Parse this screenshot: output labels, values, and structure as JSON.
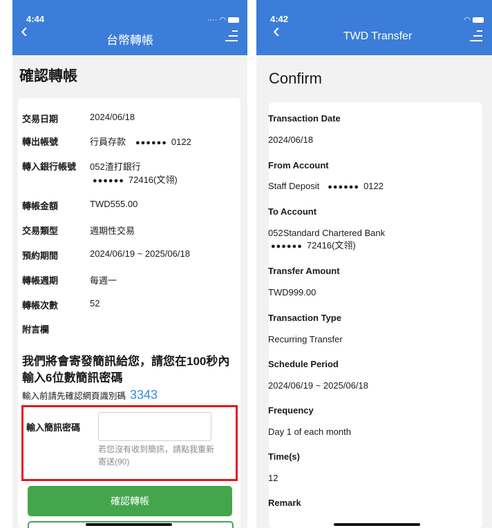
{
  "left": {
    "status_time": "4:44",
    "nav_title": "台幣轉帳",
    "page_title": "確認轉帳",
    "rows": [
      {
        "label": "交易日期",
        "value": "2024/06/18"
      },
      {
        "label": "轉出帳號",
        "value": "行員存款",
        "mask": "●●●●●●",
        "tail": "0122"
      },
      {
        "label": "轉入銀行帳號",
        "value": "052渣打銀行",
        "mask": "●●●●●●",
        "tail": "72416(文翎)"
      },
      {
        "label": "轉帳金額",
        "value": "TWD555.00"
      },
      {
        "label": "交易類型",
        "value": "週期性交易"
      },
      {
        "label": "預約期間",
        "value": "2024/06/19 ~ 2025/06/18"
      },
      {
        "label": "轉帳週期",
        "value": "每週一"
      },
      {
        "label": "轉帳次數",
        "value": "52"
      },
      {
        "label": "附言欄",
        "value": ""
      }
    ],
    "notice": "我們將會寄發簡訊給您，請您在100秒內輸入6位數簡訊密碼",
    "verify_label": "輸入前請先確認網頁識別碼",
    "verify_code": "3343",
    "sms_label": "輸入簡訊密碼",
    "sms_value": "",
    "resend_text": "若您沒有收到簡訊，請點我重新寄送(90)",
    "confirm_button": "確認轉帳"
  },
  "right": {
    "status_time": "4:42",
    "nav_title": "TWD Transfer",
    "page_title": "Confirm",
    "rows": [
      {
        "label": "Transaction Date",
        "value": "2024/06/18"
      },
      {
        "label": "From Account",
        "value": "Staff Deposit",
        "mask": "●●●●●●",
        "tail": "0122"
      },
      {
        "label": "To Account",
        "value": "052Standard Chartered Bank",
        "mask": "●●●●●●",
        "tail": "72416(文翎)"
      },
      {
        "label": "Transfer Amount",
        "value": "TWD999.00"
      },
      {
        "label": "Transaction Type",
        "value": "Recurring Transfer"
      },
      {
        "label": "Schedule Period",
        "value": "2024/06/19 ~ 2025/06/18"
      },
      {
        "label": "Frequency",
        "value": "Day 1 of each month"
      },
      {
        "label": "Time(s)",
        "value": "12"
      },
      {
        "label": "Remark",
        "value": ""
      }
    ]
  },
  "colors": {
    "appbar": "#3c7dd9",
    "confirm": "#44a64c",
    "highlight": "#e4141b",
    "code": "#2f8de4"
  }
}
